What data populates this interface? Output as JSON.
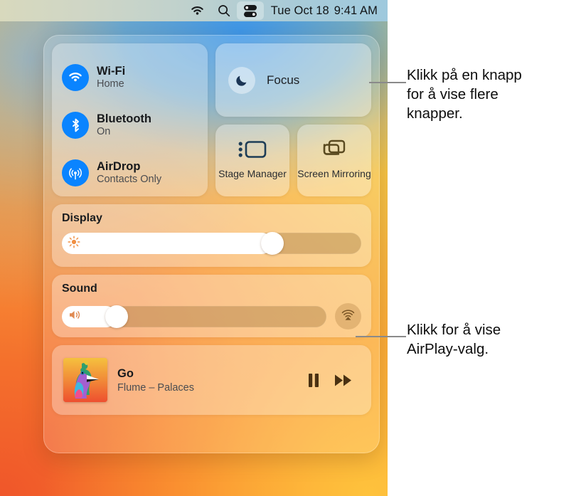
{
  "menubar": {
    "icons": [
      {
        "name": "wifi-icon",
        "label": "Wi-Fi"
      },
      {
        "name": "search-icon",
        "label": "Spotlight"
      },
      {
        "name": "control-center-icon",
        "label": "Control Center"
      }
    ],
    "clock": {
      "date": "Tue Oct 18",
      "time": "9:41 AM"
    }
  },
  "control_center": {
    "connectivity": [
      {
        "icon": "wifi-icon",
        "title": "Wi-Fi",
        "status": "Home"
      },
      {
        "icon": "bluetooth-icon",
        "title": "Bluetooth",
        "status": "On"
      },
      {
        "icon": "airdrop-icon",
        "title": "AirDrop",
        "status": "Contacts Only"
      }
    ],
    "focus": {
      "icon": "moon-icon",
      "label": "Focus"
    },
    "tiles": [
      {
        "icon": "stage-manager-icon",
        "label": "Stage\nManager"
      },
      {
        "icon": "screen-mirroring-icon",
        "label": "Screen\nMirroring"
      }
    ],
    "display": {
      "title": "Display",
      "icon": "brightness-icon",
      "value": 72
    },
    "sound": {
      "title": "Sound",
      "icon": "speaker-icon",
      "value": 18,
      "airplay_icon": "airplay-audio-icon"
    },
    "now_playing": {
      "artwork": "album-artwork-bird",
      "title": "Go",
      "subtitle": "Flume – Palaces",
      "controls": [
        {
          "name": "pause-button",
          "icon": "pause-icon"
        },
        {
          "name": "fast-forward-button",
          "icon": "fast-forward-icon"
        }
      ]
    }
  },
  "callouts": [
    {
      "text": "Klikk på en knapp\nfor å vise flere\nknapper."
    },
    {
      "text": "Klikk for å vise\nAirPlay-valg."
    }
  ],
  "colors": {
    "accent_blue": "#0a84ff",
    "menubar_text": "#111416",
    "callout_text": "#0d0d0d",
    "leader_line": "#8a8a8a"
  }
}
